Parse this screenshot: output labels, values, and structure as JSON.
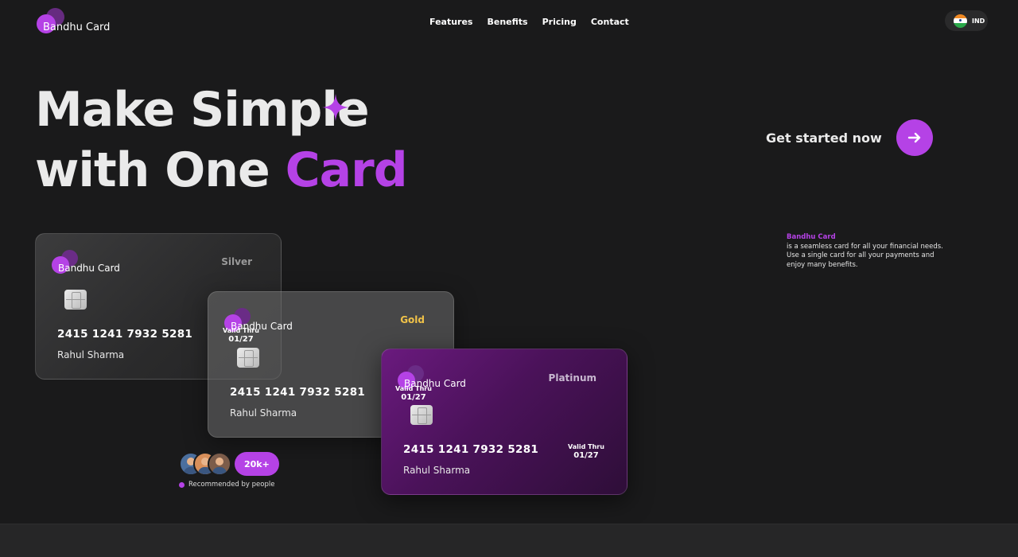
{
  "brand": {
    "name": "Bandhu Card"
  },
  "nav": {
    "items": [
      "Features",
      "Benefits",
      "Pricing",
      "Contact"
    ]
  },
  "language": {
    "code": "IND"
  },
  "hero": {
    "line1": "Make Simple",
    "line2_prefix": "with One",
    "line2_accent": "Card"
  },
  "cta": {
    "label": "Get started now"
  },
  "description": {
    "brand": "Bandhu Card",
    "line1": "is a seamless card for all your financial needs.",
    "line2": "Use a single card for all your payments and",
    "line3": "enjoy many benefits."
  },
  "cards": [
    {
      "tier": "Silver",
      "brand": "Bandhu Card",
      "number": "2415 1241 7932 5281",
      "holder": "Rahul Sharma",
      "valid_label": "Valid Thru",
      "valid_date": "01/27"
    },
    {
      "tier": "Gold",
      "brand": "Bandhu Card",
      "number": "2415 1241 7932 5281",
      "holder": "Rahul Sharma",
      "valid_label": "Valid Thru",
      "valid_date": "01/27"
    },
    {
      "tier": "Platinum",
      "brand": "Bandhu Card",
      "number": "2415 1241 7932 5281",
      "holder": "Rahul Sharma",
      "valid_label": "Valid Thru",
      "valid_date": "01/27"
    }
  ],
  "recommend": {
    "count": "20k+",
    "label": "Recommended by people"
  },
  "colors": {
    "accent": "#b542e6",
    "background": "#1a1a1b",
    "gold": "#f0c248"
  }
}
